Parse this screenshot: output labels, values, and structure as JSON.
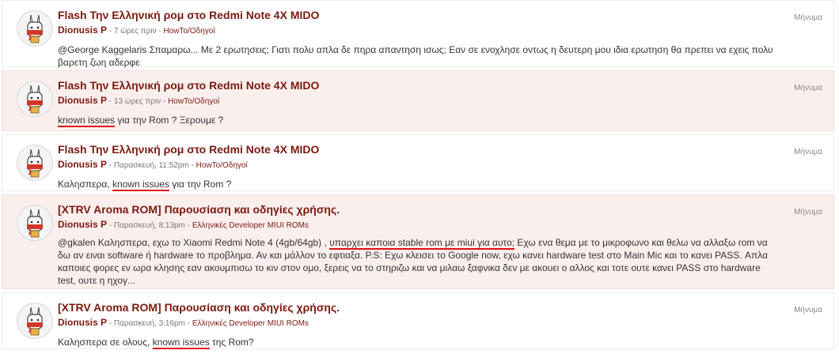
{
  "posts": [
    {
      "title": "Flash Την Ελληνική ρομ στο Redmi Note 4X MIDO",
      "user": "Dionusis P",
      "time": "7 ώρες πριν",
      "forum": "HowTo/Οδηγοί",
      "type": "Μήνυμα",
      "body": {
        "plain": "@George Kaggelaris Σπαμαρω... Με 2 ερωτησεις; Γιατι πολυ απλα δε πηρα απαντηση ισως; Εαν σε ενοχλησε οντως η δευτερη μου ιδια ερωτηση θα πρεπει να εχεις πολυ βαρετη ζωη αδερφε"
      }
    },
    {
      "title": "Flash Την Ελληνική ρομ στο Redmi Note 4X MIDO",
      "user": "Dionusis P",
      "time": "13 ώρες πριν",
      "forum": "HowTo/Οδηγοί",
      "type": "Μήνυμα",
      "body": {
        "hl": "known issues",
        "after": " για την Rom ? Ξερουμε ?"
      }
    },
    {
      "title": "Flash Την Ελληνική ρομ στο Redmi Note 4X MIDO",
      "user": "Dionusis P",
      "time": "Παρασκευή, 11:52pm",
      "forum": "HowTo/Οδηγοί",
      "type": "Μήνυμα",
      "body": {
        "before": "Καλησπερα, ",
        "hl": "known issues",
        "after": " για την Rom ?"
      }
    },
    {
      "title": "[XTRV Aroma ROM] Παρουσίαση και οδηγίες χρήσης.",
      "user": "Dionusis P",
      "time": "Παρασκευή, 8:13pm",
      "forum": "Ελληνικές Developer MIUI ROMs",
      "type": "Μήνυμα",
      "body": {
        "before": "@gkalen Καλησπερα, εχω το Xiaomi Redmi Note 4 (4gb/64gb) , ",
        "hl": "υπαρχει καποια stable rom με miui για αυτο;",
        "after": " Εχω ενα θεμα με το μικροφωνο και θελω να αλλαξω rom να δω αν ειναι software ή hardware το προβλημα. Αν και μάλλον το εφτιαξα. P.S: Εχω κλεισει το Google now, εχω κανει hardware test στο Main Mic και το κανει PASS. Απλα καποιες φορες εν ωρα κλησης εαν ακουμπισω το κιν στον ομο, ξερεις να το στηριζω και να μιλαω ξαφνικα δεν με ακουει ο αλλος και τοτε ουτε κανει PASS στο hardware test, ουτε η ηχογ..."
      }
    },
    {
      "title": "[XTRV Aroma ROM] Παρουσίαση και οδηγίες χρήσης.",
      "user": "Dionusis P",
      "time": "Παρασκευή, 3:16pm",
      "forum": "Ελληνικές Developer MIUI ROMs",
      "type": "Μήνυμα",
      "body": {
        "before": "Καλησπερα σε ολους, ",
        "hl": "known issues",
        "after": " της Rom?"
      }
    }
  ],
  "colors": {
    "accent": "#7a1a0f",
    "alt_row": "#fbefee",
    "highlight_underline": "#e01010"
  },
  "icons": {
    "avatar": "miui-bunny-avatar-icon"
  }
}
